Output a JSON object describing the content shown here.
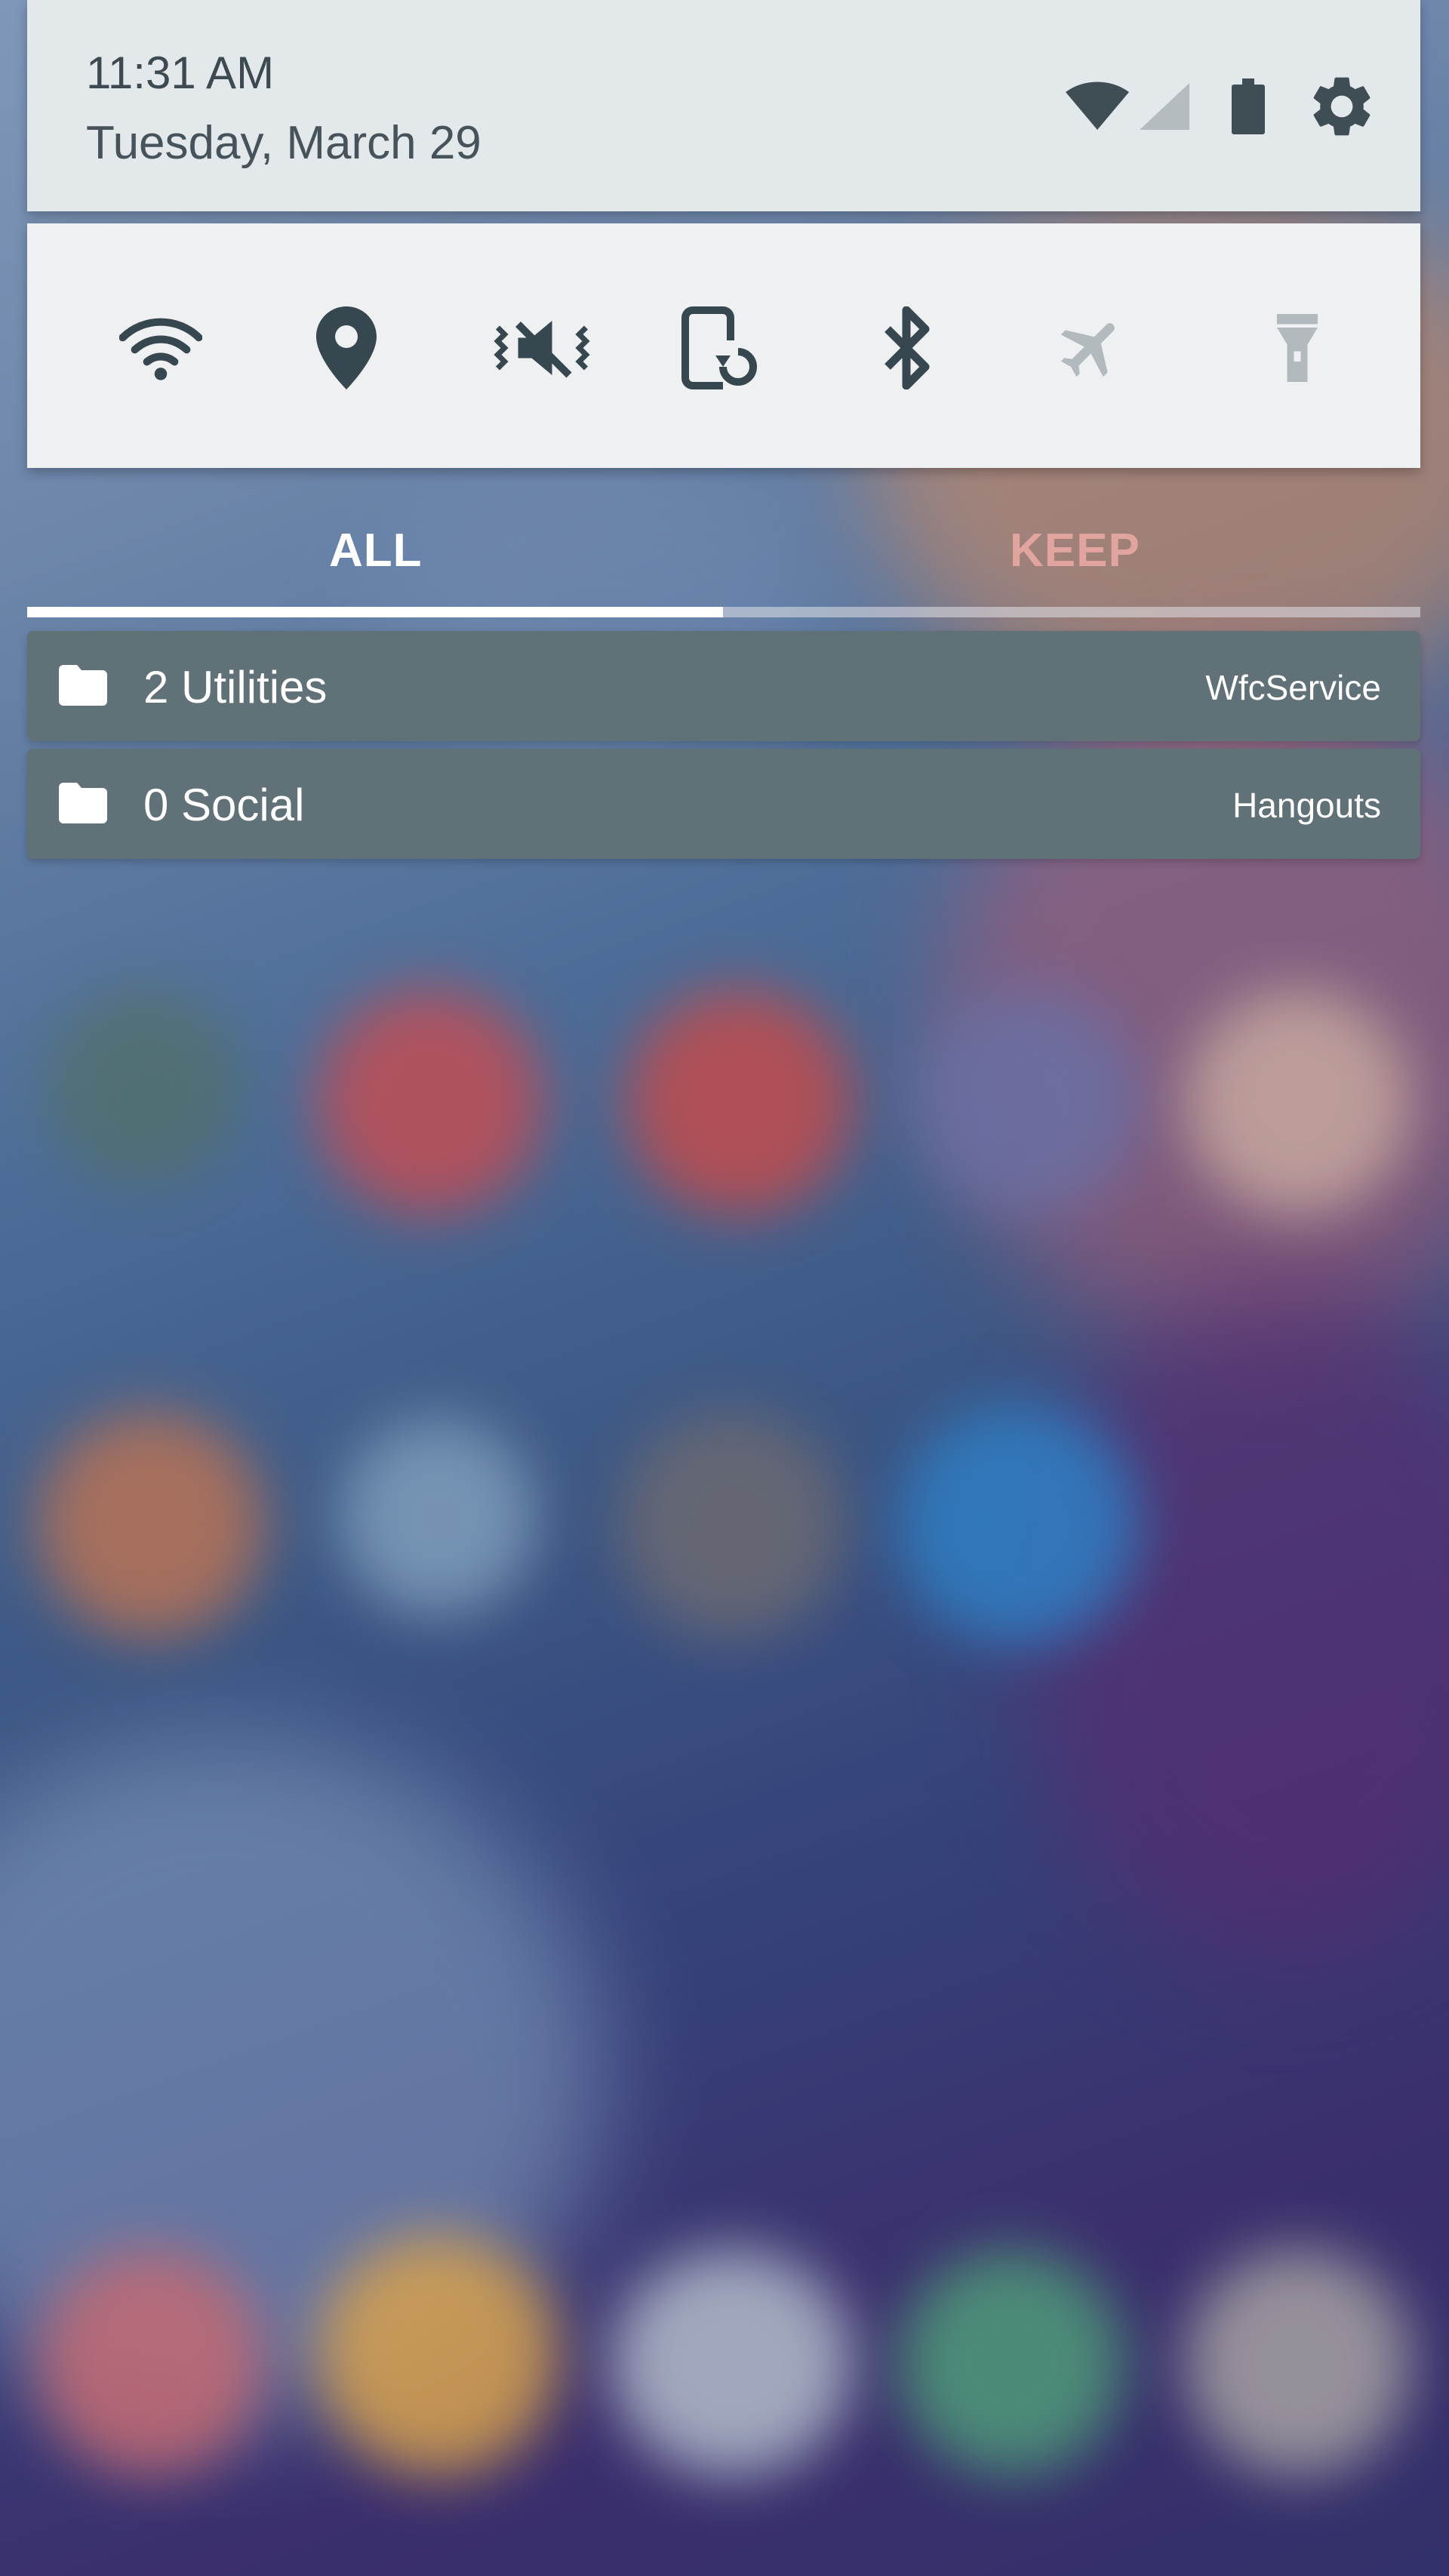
{
  "status": {
    "time": "11:31 AM",
    "date": "Tuesday, March 29",
    "icons": [
      "wifi-signal-icon",
      "cell-signal-icon",
      "battery-icon",
      "settings-gear-icon"
    ]
  },
  "quick_settings": {
    "tiles": [
      {
        "icon": "wifi-icon",
        "state": "on"
      },
      {
        "icon": "location-icon",
        "state": "on"
      },
      {
        "icon": "vibrate-mute-icon",
        "state": "on"
      },
      {
        "icon": "auto-rotate-icon",
        "state": "on"
      },
      {
        "icon": "bluetooth-icon",
        "state": "on"
      },
      {
        "icon": "airplane-mode-icon",
        "state": "off"
      },
      {
        "icon": "flashlight-icon",
        "state": "off"
      }
    ]
  },
  "tabs": {
    "items": [
      {
        "label": "ALL",
        "active": true
      },
      {
        "label": "KEEP",
        "active": false
      }
    ]
  },
  "notifications": [
    {
      "icon": "folder-icon",
      "title": "2 Utilities",
      "app": "WfcService"
    },
    {
      "icon": "folder-icon",
      "title": "0 Social",
      "app": "Hangouts"
    }
  ],
  "colors": {
    "header_bg": "#e3e8ea",
    "row_bg": "#607178",
    "icon_dark": "#37474f",
    "icon_disabled": "#b3babd",
    "keep_tab": "#e1a49e"
  }
}
